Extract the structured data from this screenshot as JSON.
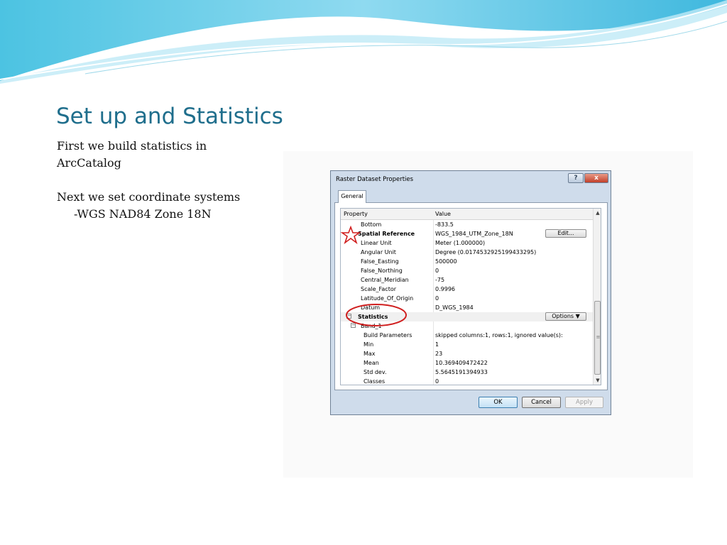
{
  "slide": {
    "title": "Set up and Statistics",
    "bullet_1": "First we build statistics in ArcCatalog",
    "bullet_2": "Next we set coordinate systems",
    "bullet_3": "-WGS NAD84  Zone 18N"
  },
  "dialog": {
    "title": "Raster Dataset Properties",
    "help_label": "?",
    "close_label": "x",
    "tab_label": "General",
    "header_property": "Property",
    "header_value": "Value",
    "rows": [
      {
        "property": "Bottom",
        "value": "-833.5"
      },
      {
        "property": "Spatial Reference",
        "value": "WGS_1984_UTM_Zone_18N",
        "button": "Edit..."
      },
      {
        "property": "Linear Unit",
        "value": "Meter (1.000000)"
      },
      {
        "property": "Angular Unit",
        "value": "Degree (0.0174532925199433295)"
      },
      {
        "property": "False_Easting",
        "value": "500000"
      },
      {
        "property": "False_Northing",
        "value": "0"
      },
      {
        "property": "Central_Meridian",
        "value": "-75"
      },
      {
        "property": "Scale_Factor",
        "value": "0.9996"
      },
      {
        "property": "Latitude_Of_Origin",
        "value": "0"
      },
      {
        "property": "Datum",
        "value": "D_WGS_1984"
      },
      {
        "property": "Statistics",
        "value": "",
        "button": "Options  ▼"
      },
      {
        "property": "Band_1",
        "value": ""
      },
      {
        "property": "Build Parameters",
        "value": "skipped columns:1, rows:1, ignored value(s):"
      },
      {
        "property": "Min",
        "value": "1"
      },
      {
        "property": "Max",
        "value": "23"
      },
      {
        "property": "Mean",
        "value": "10.369409472422"
      },
      {
        "property": "Std dev.",
        "value": "5.5645191394933"
      },
      {
        "property": "Classes",
        "value": "0"
      }
    ],
    "ok_label": "OK",
    "cancel_label": "Cancel",
    "apply_label": "Apply"
  },
  "colors": {
    "title": "#1f6e8c",
    "annotation_red": "#d01f1f",
    "dialog_frame": "#cfdceb"
  },
  "icons": {
    "expander": "minus-box-icon",
    "scroll_up": "triangle-up-icon",
    "scroll_down": "triangle-down-icon",
    "annotation": "star-icon"
  }
}
